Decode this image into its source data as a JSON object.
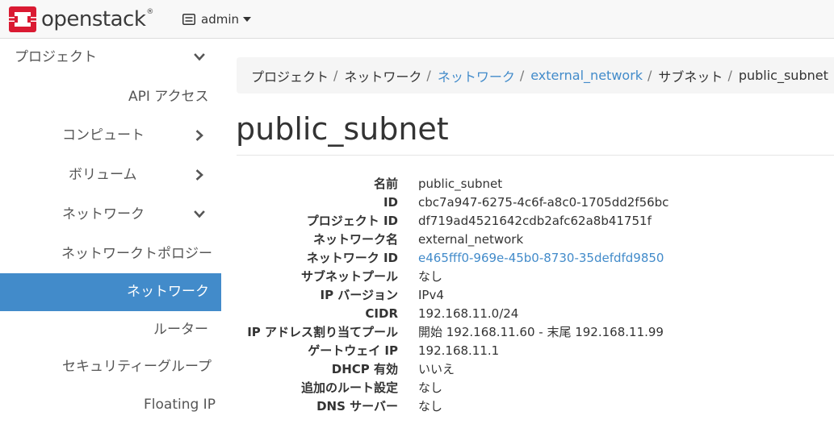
{
  "brand": {
    "name": "openstack",
    "registered": "®",
    "logo_color": "#da1a32"
  },
  "header": {
    "project": "admin"
  },
  "sidebar": {
    "items": [
      {
        "label": "プロジェクト"
      },
      {
        "label": "API アクセス"
      },
      {
        "label": "コンピュート"
      },
      {
        "label": "ボリューム"
      },
      {
        "label": "ネットワーク"
      },
      {
        "label": "ネットワークトポロジー"
      },
      {
        "label": "ネットワーク"
      },
      {
        "label": "ルーター"
      },
      {
        "label": "セキュリティーグループ"
      },
      {
        "label": "Floating IP"
      }
    ]
  },
  "breadcrumb": {
    "items": [
      "プロジェクト",
      "ネットワーク",
      "ネットワーク",
      "external_network",
      "サブネット",
      "public_subnet"
    ],
    "separator": "/"
  },
  "page": {
    "title": "public_subnet"
  },
  "details": [
    {
      "label": "名前",
      "value": "public_subnet"
    },
    {
      "label": "ID",
      "value": "cbc7a947-6275-4c6f-a8c0-1705dd2f56bc"
    },
    {
      "label": "プロジェクト ID",
      "value": "df719ad4521642cdb2afc62a8b41751f"
    },
    {
      "label": "ネットワーク名",
      "value": "external_network"
    },
    {
      "label": "ネットワーク ID",
      "value": "e465fff0-969e-45b0-8730-35defdfd9850"
    },
    {
      "label": "サブネットプール",
      "value": "なし"
    },
    {
      "label": "IP バージョン",
      "value": "IPv4"
    },
    {
      "label": "CIDR",
      "value": "192.168.11.0/24"
    },
    {
      "label": "IP アドレス割り当てプール",
      "value": "開始 192.168.11.60 - 末尾 192.168.11.99"
    },
    {
      "label": "ゲートウェイ IP",
      "value": "192.168.11.1"
    },
    {
      "label": "DHCP 有効",
      "value": "いいえ"
    },
    {
      "label": "追加のルート設定",
      "value": "なし"
    },
    {
      "label": "DNS サーバー",
      "value": "なし"
    }
  ],
  "colors": {
    "accent": "#428bca",
    "active_nav_bg": "#428bca",
    "brand_red": "#da1a32"
  }
}
